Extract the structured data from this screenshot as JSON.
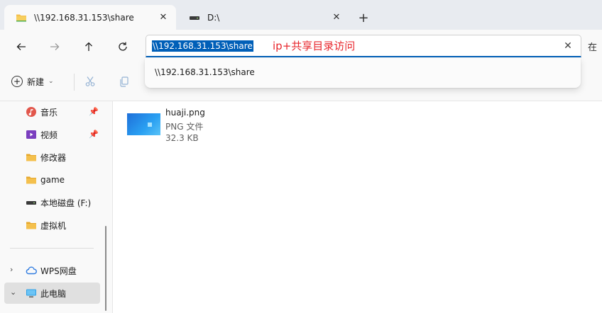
{
  "tabs": [
    {
      "title": "\\\\192.168.31.153\\share",
      "active": true,
      "icon": "folder-icon"
    },
    {
      "title": "D:\\",
      "active": false,
      "icon": "drive-icon"
    }
  ],
  "navbar": {
    "address_value": "\\\\192.168.31.153\\share",
    "annotation": "ip+共享目录访问",
    "right_partial": "在"
  },
  "dropdown": {
    "suggestion": "\\\\192.168.31.153\\share"
  },
  "commandbar": {
    "new_label": "新建"
  },
  "sidebar": {
    "items": [
      {
        "label": "音乐",
        "icon": "music-icon",
        "pinned": true
      },
      {
        "label": "视频",
        "icon": "video-icon",
        "pinned": true
      },
      {
        "label": "修改器",
        "icon": "folder-icon"
      },
      {
        "label": "game",
        "icon": "folder-icon"
      },
      {
        "label": "本地磁盘 (F:)",
        "icon": "drive-icon"
      },
      {
        "label": "虚拟机",
        "icon": "folder-icon"
      }
    ],
    "sections": [
      {
        "label": "WPS网盘",
        "icon": "cloud-icon",
        "expanded": false
      },
      {
        "label": "此电脑",
        "icon": "computer-icon",
        "expanded": true,
        "selected": true
      }
    ]
  },
  "files": [
    {
      "name": "huaji.png",
      "type": "PNG 文件",
      "size": "32.3 KB"
    }
  ],
  "colors": {
    "accent": "#005fb8",
    "annotation": "#e8262c",
    "folder": "#f4c04d"
  }
}
